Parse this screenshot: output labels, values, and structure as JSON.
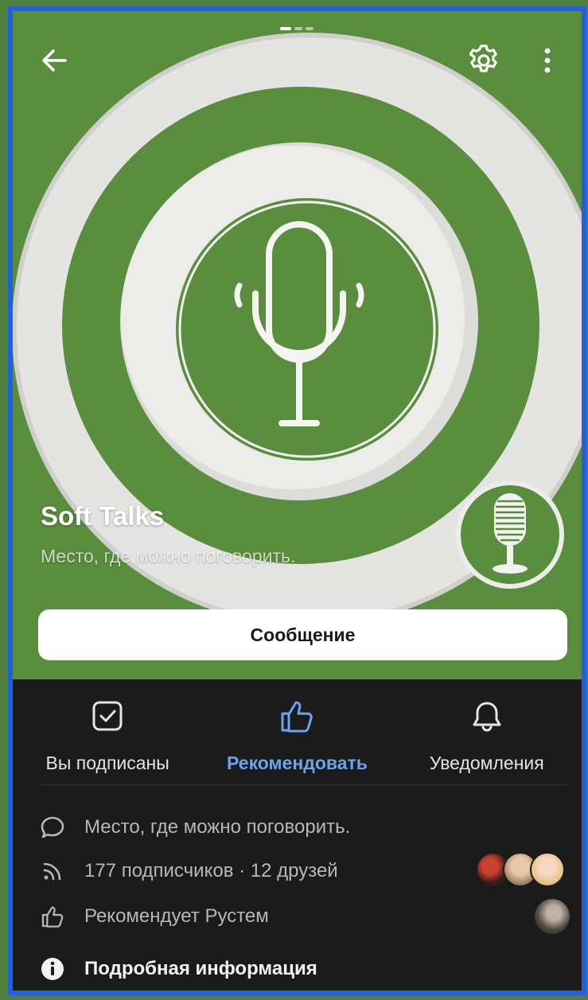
{
  "group": {
    "name": "Soft Talks",
    "status": "Место, где можно поговорить."
  },
  "cover": {
    "colors": {
      "green": "#5a8d3d",
      "light": "#e6e6e4",
      "shadow": "#b7b7b5"
    }
  },
  "topbar": {
    "icons": [
      "back-arrow-icon",
      "gear-icon",
      "more-vertical-icon"
    ]
  },
  "message_button": {
    "label": "Сообщение"
  },
  "actions": [
    {
      "label": "Вы подписаны",
      "icon": "checkbox-checked-icon",
      "accent": false
    },
    {
      "label": "Рекомендовать",
      "icon": "thumbs-up-icon",
      "accent": true
    },
    {
      "label": "Уведомления",
      "icon": "bell-icon",
      "accent": false
    }
  ],
  "info": {
    "status": "Место, где можно поговорить.",
    "subscribers": "177 подписчиков · 12 друзей",
    "recommended_by": "Рекомендует Рустем",
    "details": "Подробная информация"
  },
  "colors": {
    "accent": "#6aa4ee",
    "background": "#1b1b1c",
    "frame_border": "#1f5fe0"
  }
}
